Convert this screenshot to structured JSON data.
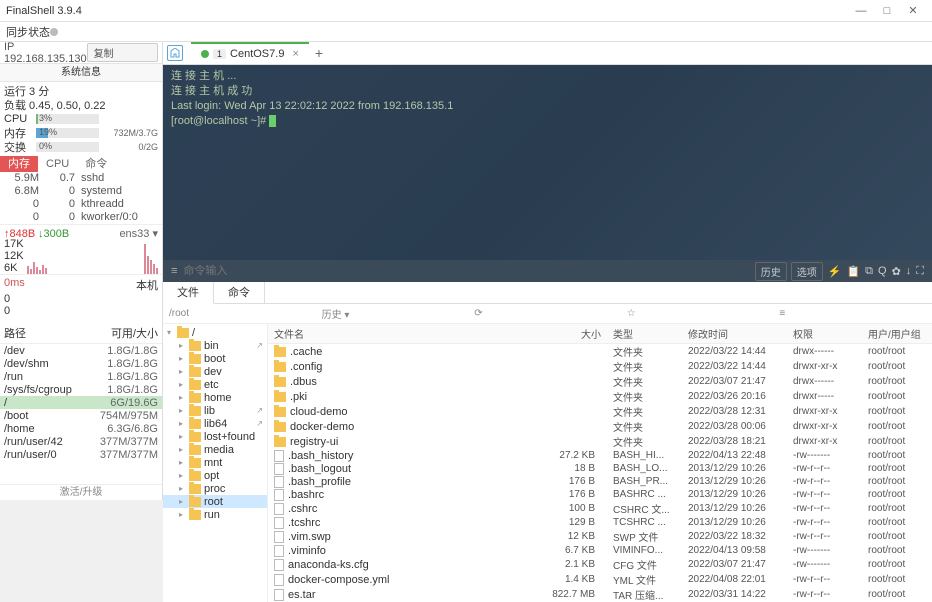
{
  "app": {
    "title": "FinalShell 3.9.4",
    "sync_status": "同步状态"
  },
  "ip": {
    "addr": "IP 192.168.135.130",
    "copy": "复制"
  },
  "sysinfo_label": "系统信息",
  "metrics": {
    "runtime": "运行 3 分",
    "load": "负载 0.45, 0.50, 0.22",
    "cpu": {
      "label": "CPU",
      "pct": "3%"
    },
    "mem": {
      "label": "内存",
      "pct": "19%",
      "val": "732M/3.7G"
    },
    "swap": {
      "label": "交换",
      "pct": "0%",
      "val": "0/2G"
    }
  },
  "subtabs": {
    "mem": "内存",
    "cpu": "CPU",
    "cmd": "命令"
  },
  "procs": [
    {
      "m": "5.9M",
      "c": "0.7",
      "n": "sshd"
    },
    {
      "m": "6.8M",
      "c": "0",
      "n": "systemd"
    },
    {
      "m": "0",
      "c": "0",
      "n": "kthreadd"
    },
    {
      "m": "0",
      "c": "0",
      "n": "kworker/0:0"
    }
  ],
  "net": {
    "up": "↑848B",
    "dn": "↓300B",
    "iface": "ens33 ▾"
  },
  "yax": [
    "17K",
    "12K",
    "6K"
  ],
  "lat": {
    "ms": "0ms",
    "z1": "0",
    "z2": "0",
    "host": "本机"
  },
  "disk": {
    "h1": "路径",
    "h2": "可用/大小",
    "rows": [
      {
        "p": "/dev",
        "s": "1.8G/1.8G"
      },
      {
        "p": "/dev/shm",
        "s": "1.8G/1.8G"
      },
      {
        "p": "/run",
        "s": "1.8G/1.8G"
      },
      {
        "p": "/sys/fs/cgroup",
        "s": "1.8G/1.8G"
      },
      {
        "p": "/",
        "s": "6G/19.6G",
        "hl": true
      },
      {
        "p": "/boot",
        "s": "754M/975M"
      },
      {
        "p": "/home",
        "s": "6.3G/6.8G"
      },
      {
        "p": "/run/user/42",
        "s": "377M/377M"
      },
      {
        "p": "/run/user/0",
        "s": "377M/377M"
      }
    ]
  },
  "upgrade": "激活/升级",
  "tab": {
    "num": "1",
    "name": "CentOS7.9"
  },
  "term": {
    "l1": "连 接 主 机 ...",
    "l2": "连 接 主 机 成 功",
    "l3": "Last login: Wed Apr 13 22:02:12 2022 from 192.168.135.1",
    "l4": "[root@localhost ~]# ",
    "cmd_ph": "命令输入",
    "hist": "历史",
    "opt": "选项"
  },
  "fm": {
    "t1": "文件",
    "t2": "命令",
    "path": "/root",
    "hist": "历史",
    "th": {
      "name": "文件名",
      "size": "大小",
      "type": "类型",
      "mtime": "修改时间",
      "perm": "权限",
      "owner": "用户/用户组"
    },
    "tree": [
      "/",
      "bin",
      "boot",
      "dev",
      "etc",
      "home",
      "lib",
      "lib64",
      "lost+found",
      "media",
      "mnt",
      "opt",
      "proc",
      "root",
      "run"
    ],
    "files": [
      {
        "n": ".cache",
        "s": "",
        "t": "文件夹",
        "m": "2022/03/22 14:44",
        "p": "drwx------",
        "o": "root/root",
        "d": true
      },
      {
        "n": ".config",
        "s": "",
        "t": "文件夹",
        "m": "2022/03/22 14:44",
        "p": "drwxr-xr-x",
        "o": "root/root",
        "d": true
      },
      {
        "n": ".dbus",
        "s": "",
        "t": "文件夹",
        "m": "2022/03/07 21:47",
        "p": "drwx------",
        "o": "root/root",
        "d": true
      },
      {
        "n": ".pki",
        "s": "",
        "t": "文件夹",
        "m": "2022/03/26 20:16",
        "p": "drwxr-----",
        "o": "root/root",
        "d": true
      },
      {
        "n": "cloud-demo",
        "s": "",
        "t": "文件夹",
        "m": "2022/03/28 12:31",
        "p": "drwxr-xr-x",
        "o": "root/root",
        "d": true
      },
      {
        "n": "docker-demo",
        "s": "",
        "t": "文件夹",
        "m": "2022/03/28 00:06",
        "p": "drwxr-xr-x",
        "o": "root/root",
        "d": true
      },
      {
        "n": "registry-ui",
        "s": "",
        "t": "文件夹",
        "m": "2022/03/28 18:21",
        "p": "drwxr-xr-x",
        "o": "root/root",
        "d": true
      },
      {
        "n": ".bash_history",
        "s": "27.2 KB",
        "t": "BASH_HI...",
        "m": "2022/04/13 22:48",
        "p": "-rw-------",
        "o": "root/root"
      },
      {
        "n": ".bash_logout",
        "s": "18 B",
        "t": "BASH_LO...",
        "m": "2013/12/29 10:26",
        "p": "-rw-r--r--",
        "o": "root/root"
      },
      {
        "n": ".bash_profile",
        "s": "176 B",
        "t": "BASH_PR...",
        "m": "2013/12/29 10:26",
        "p": "-rw-r--r--",
        "o": "root/root"
      },
      {
        "n": ".bashrc",
        "s": "176 B",
        "t": "BASHRC ...",
        "m": "2013/12/29 10:26",
        "p": "-rw-r--r--",
        "o": "root/root"
      },
      {
        "n": ".cshrc",
        "s": "100 B",
        "t": "CSHRC 文...",
        "m": "2013/12/29 10:26",
        "p": "-rw-r--r--",
        "o": "root/root"
      },
      {
        "n": ".tcshrc",
        "s": "129 B",
        "t": "TCSHRC ...",
        "m": "2013/12/29 10:26",
        "p": "-rw-r--r--",
        "o": "root/root"
      },
      {
        "n": ".vim.swp",
        "s": "12 KB",
        "t": "SWP 文件",
        "m": "2022/03/22 18:32",
        "p": "-rw-r--r--",
        "o": "root/root"
      },
      {
        "n": ".viminfo",
        "s": "6.7 KB",
        "t": "VIMINFO...",
        "m": "2022/04/13 09:58",
        "p": "-rw-------",
        "o": "root/root"
      },
      {
        "n": "anaconda-ks.cfg",
        "s": "2.1 KB",
        "t": "CFG 文件",
        "m": "2022/03/07 21:47",
        "p": "-rw-------",
        "o": "root/root"
      },
      {
        "n": "docker-compose.yml",
        "s": "1.4 KB",
        "t": "YML 文件",
        "m": "2022/04/08 22:01",
        "p": "-rw-r--r--",
        "o": "root/root"
      },
      {
        "n": "es.tar",
        "s": "822.7 MB",
        "t": "TAR 压缩...",
        "m": "2022/03/31 14:22",
        "p": "-rw-r--r--",
        "o": "root/root"
      }
    ]
  }
}
